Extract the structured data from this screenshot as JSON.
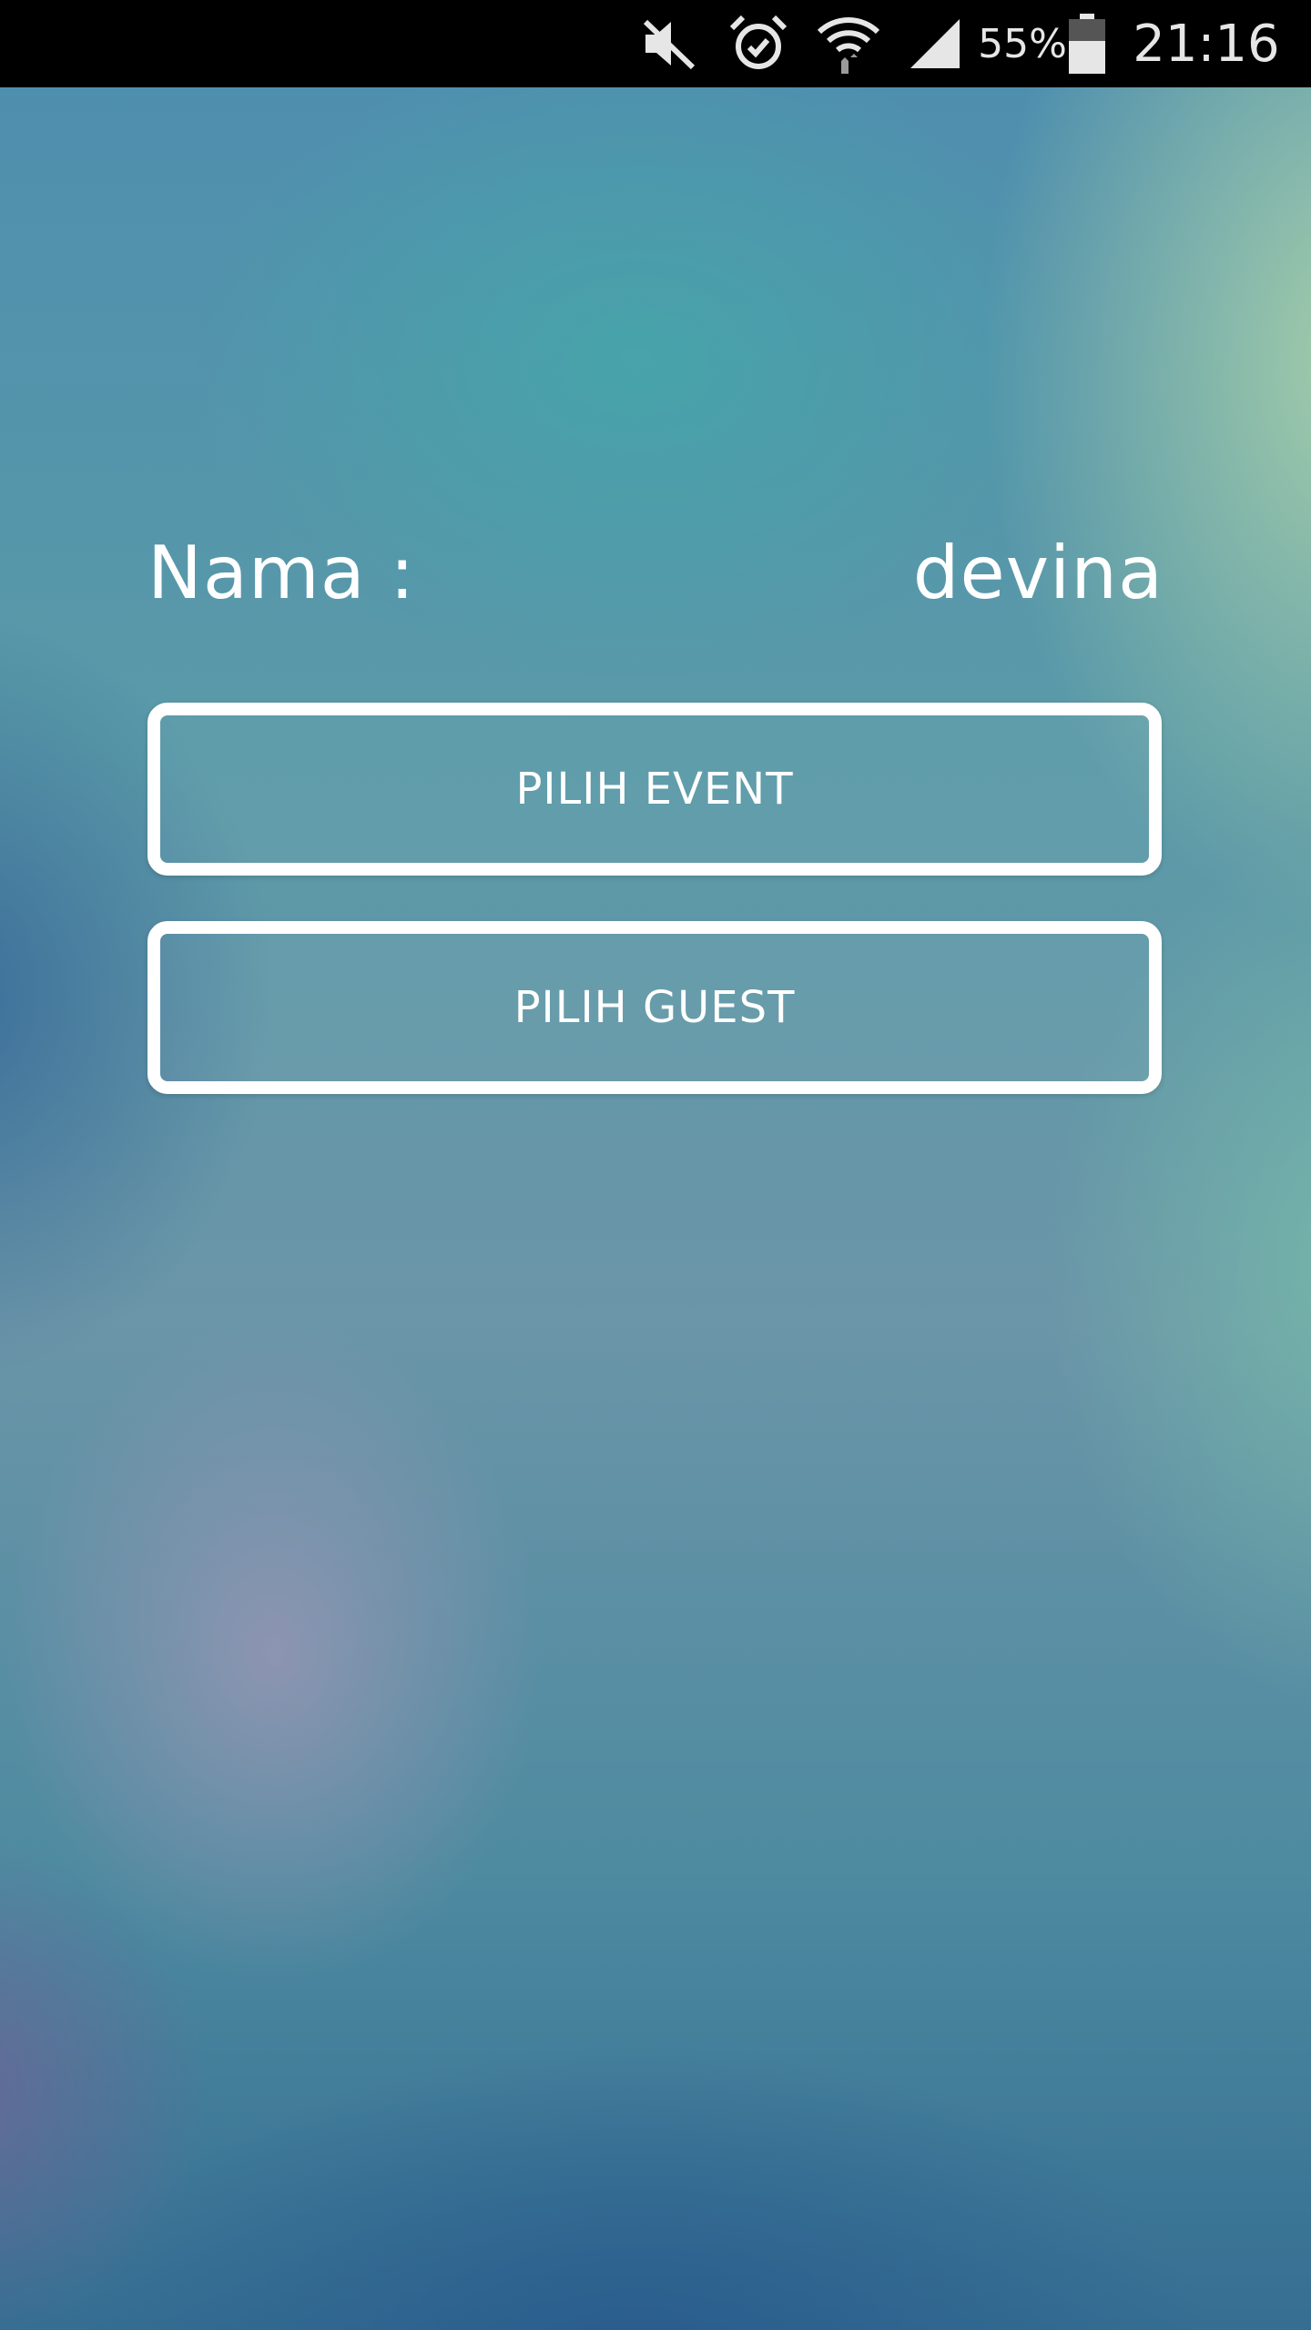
{
  "status_bar": {
    "icons": [
      "mute-icon",
      "alarm-icon",
      "wifi-icon",
      "signal-icon",
      "battery-icon"
    ],
    "battery_percent": "55%",
    "time": "21:16"
  },
  "main": {
    "name_label": "Nama :",
    "name_value": "devina",
    "buttons": {
      "pilih_event": "PILIH EVENT",
      "pilih_guest": "PILIH GUEST"
    }
  },
  "colors": {
    "status_bar_bg": "#000000",
    "text": "#ffffff",
    "button_border": "#ffffff"
  }
}
